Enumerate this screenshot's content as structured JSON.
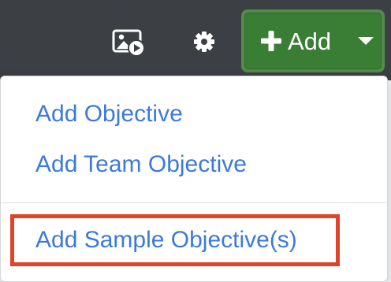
{
  "toolbar": {
    "icons": {
      "media": "media-gallery-icon",
      "settings": "gear-icon"
    },
    "add_button": {
      "label": "Add",
      "icon": "plus-icon",
      "dropdown_icon": "caret-down-icon",
      "color": "#3a7d34"
    }
  },
  "dropdown": {
    "items": [
      {
        "label": "Add Objective"
      },
      {
        "label": "Add Team Objective"
      },
      {
        "label": "Add Sample Objective(s)",
        "highlighted": true
      }
    ],
    "link_color": "#3b7ad9",
    "highlight_color": "#e1432a"
  }
}
